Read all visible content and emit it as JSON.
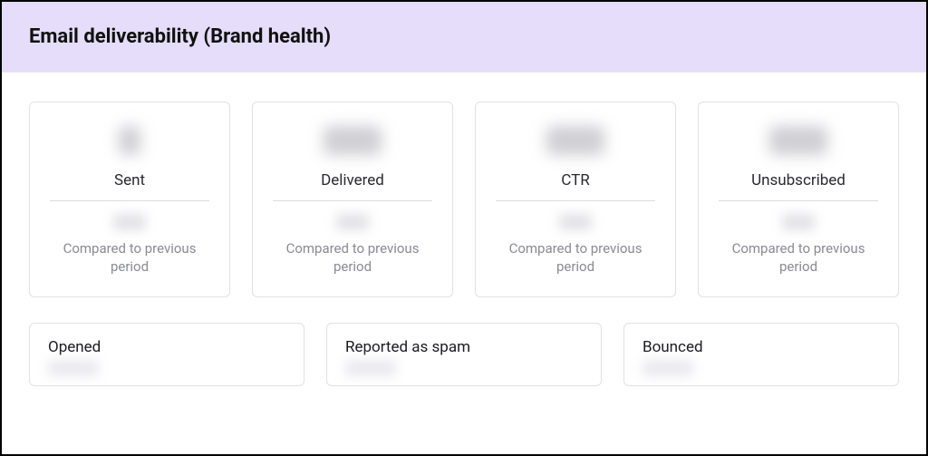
{
  "header": {
    "title": "Email deliverability (Brand health)"
  },
  "topCards": [
    {
      "label": "Sent",
      "compare": "Compared to previous period"
    },
    {
      "label": "Delivered",
      "compare": "Compared to previous period"
    },
    {
      "label": "CTR",
      "compare": "Compared to previous period"
    },
    {
      "label": "Unsubscribed",
      "compare": "Compared to previous period"
    }
  ],
  "bottomCards": [
    {
      "label": "Opened"
    },
    {
      "label": "Reported as spam"
    },
    {
      "label": "Bounced"
    }
  ]
}
